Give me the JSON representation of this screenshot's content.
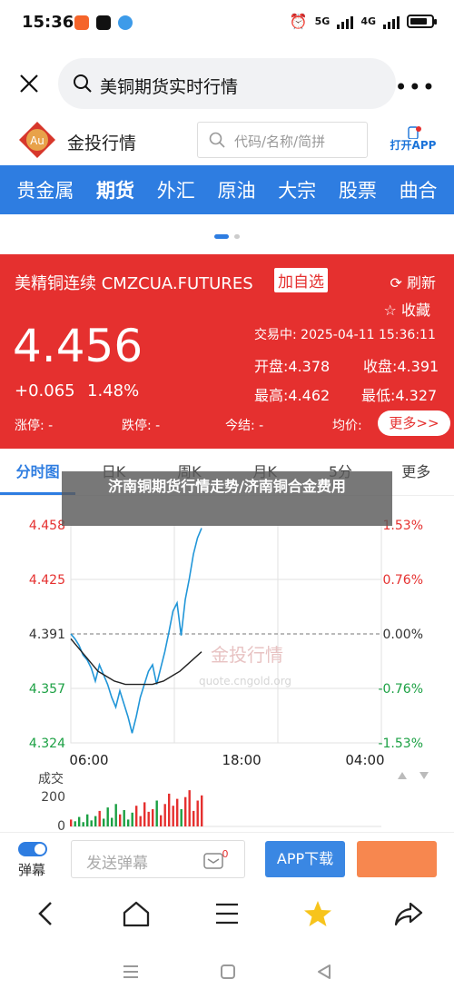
{
  "status": {
    "time": "15:36",
    "net1": "5G",
    "net2": "4G"
  },
  "browser": {
    "query": "美铜期货实时行情"
  },
  "site": {
    "brand": "金投行情",
    "logo_text": "Au",
    "search_placeholder": "代码/名称/简拼",
    "open_app": "打开APP"
  },
  "nav": {
    "items": [
      "贵金属",
      "期货",
      "外汇",
      "原油",
      "大宗",
      "股票",
      "曲合"
    ]
  },
  "quote": {
    "title": "美精铜连续 CMZCUA.FUTURES",
    "add_label": "加自选",
    "refresh": "刷新",
    "favorite": "收藏",
    "price": "4.456",
    "change": "+0.065",
    "change_pct": "1.48%",
    "trade_time": "交易中: 2025-04-11 15:36:11",
    "open": "开盘:4.378",
    "prev_close": "收盘:4.391",
    "high": "最高:4.462",
    "low": "最低:4.327",
    "limit_up": "涨停: -",
    "limit_down": "跌停: -",
    "settle": "今结: -",
    "avg": "均价:",
    "more": "更多>>"
  },
  "tabs": [
    "分时图",
    "日K",
    "周K",
    "月K",
    "5分",
    "更多"
  ],
  "overlay_title": "济南铜期货行情走势/济南铜合金费用",
  "chart_data": {
    "type": "line",
    "y_left_ticks": [
      "4.458",
      "4.425",
      "4.391",
      "4.357",
      "4.324"
    ],
    "y_right_ticks": [
      "1.53%",
      "0.76%",
      "0.00%",
      "-0.76%",
      "-1.53%"
    ],
    "x_ticks": [
      "06:00",
      "18:00",
      "04:00"
    ],
    "ylim": [
      4.324,
      4.458
    ],
    "reference": 4.391,
    "price_series": [
      4.391,
      4.388,
      4.384,
      4.378,
      4.375,
      4.37,
      4.362,
      4.372,
      4.366,
      4.36,
      4.352,
      4.346,
      4.356,
      4.348,
      4.34,
      4.33,
      4.34,
      4.352,
      4.36,
      4.368,
      4.372,
      4.36,
      4.37,
      4.38,
      4.392,
      4.405,
      4.41,
      4.39,
      4.412,
      4.425,
      4.44,
      4.45,
      4.456
    ],
    "avg_series": [
      4.388,
      4.384,
      4.38,
      4.376,
      4.372,
      4.368,
      4.366,
      4.364,
      4.362,
      4.361,
      4.36,
      4.36,
      4.36,
      4.36,
      4.36,
      4.36,
      4.361,
      4.362,
      4.364,
      4.366,
      4.368,
      4.371,
      4.374,
      4.377,
      4.38
    ],
    "volume_label": "成交",
    "volume_ticks": [
      "200",
      "0"
    ],
    "volume_values": [
      40,
      30,
      55,
      25,
      70,
      35,
      60,
      90,
      45,
      110,
      50,
      130,
      70,
      95,
      40,
      80,
      120,
      60,
      140,
      85,
      100,
      150,
      65,
      130,
      190,
      120,
      160,
      100,
      170,
      210,
      90,
      150,
      180
    ]
  },
  "watermark": {
    "brand": "金投行情",
    "url": "quote.cngold.org"
  },
  "comment_bar": {
    "danmu": "弹幕",
    "send_placeholder": "发送弹幕",
    "app_download": "APP下载",
    "msg_count": "0"
  },
  "colors": {
    "accent_blue": "#2e7de1",
    "quote_red": "#e5302f",
    "rise_red": "#e5302f",
    "fall_green": "#1ba043",
    "line_blue": "#2196d8"
  }
}
